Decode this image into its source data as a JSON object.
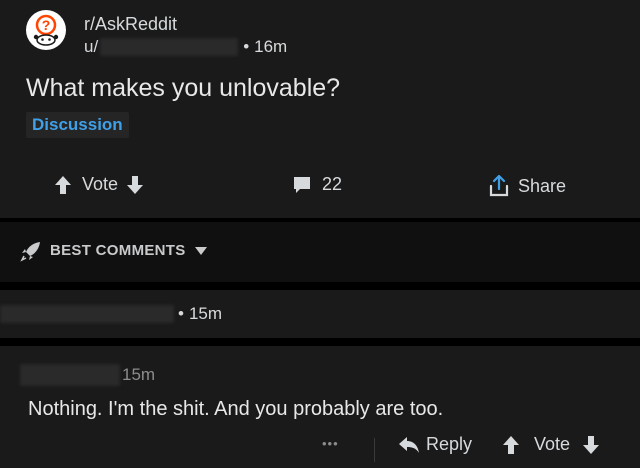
{
  "post": {
    "subreddit": "r/AskReddit",
    "author_prefix": "u/",
    "age": "16m",
    "separator": "•",
    "title": "What makes you unlovable?",
    "flair": "Discussion"
  },
  "actions": {
    "vote_label": "Vote",
    "comments_count": "22",
    "share_label": "Share"
  },
  "sort": {
    "label": "BEST COMMENTS"
  },
  "comments": [
    {
      "age": "15m",
      "separator": "•"
    },
    {
      "age": "15m",
      "body": "Nothing.  I'm the shit.  And you probably are too.",
      "more": "•••",
      "reply_label": "Reply",
      "vote_label": "Vote"
    }
  ],
  "colors": {
    "background": "#000000",
    "card": "#1a1a1b",
    "flair_text": "#3fa0e8",
    "text": "#d7dadc"
  }
}
